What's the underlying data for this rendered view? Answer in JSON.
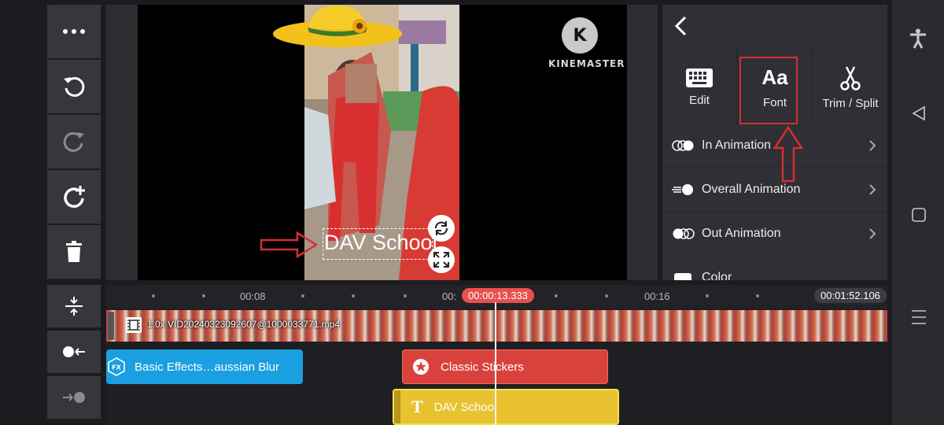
{
  "left_toolbar": {
    "more": "more",
    "undo": "undo",
    "redo": "redo",
    "add": "add",
    "delete": "delete",
    "split_view": "split",
    "keyframe_in": "keyframe",
    "keyframe_out": "keyframe"
  },
  "preview": {
    "watermark": "KINEMASTER",
    "watermark_letter": "K",
    "text_overlay": "DAV School"
  },
  "right_panel": {
    "tools": [
      {
        "label": "Edit",
        "icon": "keyboard-icon"
      },
      {
        "label": "Font",
        "icon": "font-aa-icon",
        "glyph": "Aa"
      },
      {
        "label": "Trim / Split",
        "icon": "scissors-icon"
      }
    ],
    "menu": [
      {
        "label": "In Animation",
        "icon": "in-animation-icon"
      },
      {
        "label": "Overall Animation",
        "icon": "overall-animation-icon"
      },
      {
        "label": "Out Animation",
        "icon": "out-animation-icon"
      },
      {
        "label": "Color",
        "icon": "color-swatch-icon"
      }
    ]
  },
  "timeline": {
    "tick_labels": [
      "00:08",
      "00:",
      "00:16"
    ],
    "playhead_time": "00:00:13.333",
    "total_duration": "00:01:52.106",
    "video_clip_label": "1.0x VID20240323092607@1000033771.mp4",
    "effects_clip_label": "Basic Effects…aussian Blur",
    "sticker_clip_label": "Classic Stickers",
    "text_clip_label": "DAV School",
    "effects_glyph": "FX",
    "text_glyph": "T"
  },
  "colors": {
    "accent_red": "#e85050",
    "effects_clip": "#1a9fe0",
    "sticker_clip": "#d9423c",
    "text_clip": "#e8c230",
    "annotation_red": "#d43030"
  }
}
